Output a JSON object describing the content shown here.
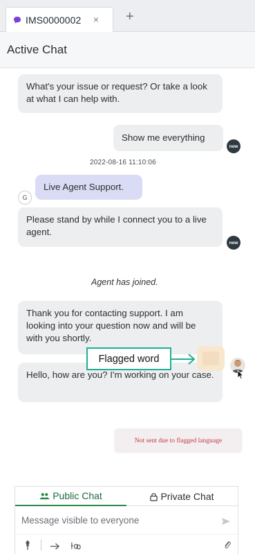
{
  "tab": {
    "label": "IMS0000002",
    "close": "×",
    "add": "+",
    "dot_color": "#7b3fd6",
    "icon": "chat-bubble-icon"
  },
  "header": {
    "title": "Active Chat"
  },
  "messages": [
    {
      "text": "What's your issue or request? Or take a look at what I can help with."
    },
    {
      "text": "Show me everything"
    },
    {
      "text": "Live Agent Support."
    },
    {
      "text": "Please stand by while I connect you to a live agent."
    },
    {
      "text": "Thank you for contacting support. I am looking into your question now and will be with you shortly."
    },
    {
      "text": "Hello, how are you? I'm working on your case."
    }
  ],
  "timestamp": "2022-08-16 11:10:06",
  "system_message": "Agent has joined.",
  "avatars": {
    "bot": "now",
    "guest": "G"
  },
  "flag_annotation": {
    "label": "Flagged word",
    "color": "#1fae93"
  },
  "not_sent_notice": "Not sent due to flagged language",
  "composer": {
    "tabs": [
      {
        "label": "Public Chat",
        "icon": "users-icon",
        "active": true
      },
      {
        "label": "Private Chat",
        "icon": "lock-icon",
        "active": false
      }
    ],
    "placeholder": "Message visible to everyone",
    "tools": [
      "pin-icon",
      "arrow-right-icon",
      "link-icon",
      "paperclip-icon"
    ],
    "send_icon": "send-icon"
  },
  "colors": {
    "bubble": "#eceef0",
    "agent_support_bubble": "#d9dcf4",
    "public_tab_accent": "#2d8a4d",
    "error_text": "#c03a40"
  }
}
